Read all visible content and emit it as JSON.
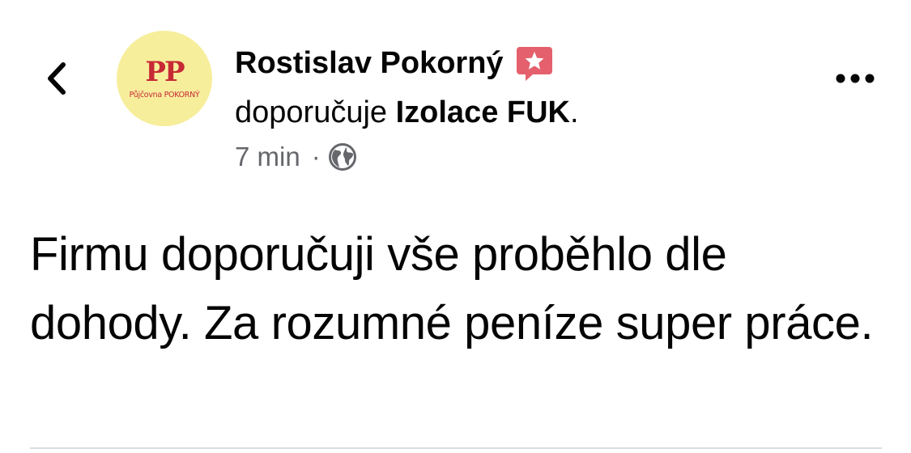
{
  "header": {
    "back_icon": "chevron-left-icon",
    "avatar": {
      "brand": "PP",
      "caption": "Půjčovna POKORNÝ",
      "background": "#f7ee9c",
      "brand_color": "#c72a35"
    },
    "author": "Rostislav Pokorný",
    "badge_icon": "star-speech-bubble-icon",
    "badge_color": "#e4606d",
    "recommend_verb": "doporučuje",
    "recommend_target": "Izolace FUK",
    "recommend_punct": ".",
    "time": "7 min",
    "separator": "·",
    "privacy_icon": "globe-icon",
    "more_icon": "more-horizontal-icon"
  },
  "post": {
    "text": "Firmu doporučuji vše proběhlo dle dohody. Za rozumné peníze super práce."
  },
  "colors": {
    "text": "#050505",
    "secondary": "#65676b",
    "divider": "#dadde1"
  }
}
